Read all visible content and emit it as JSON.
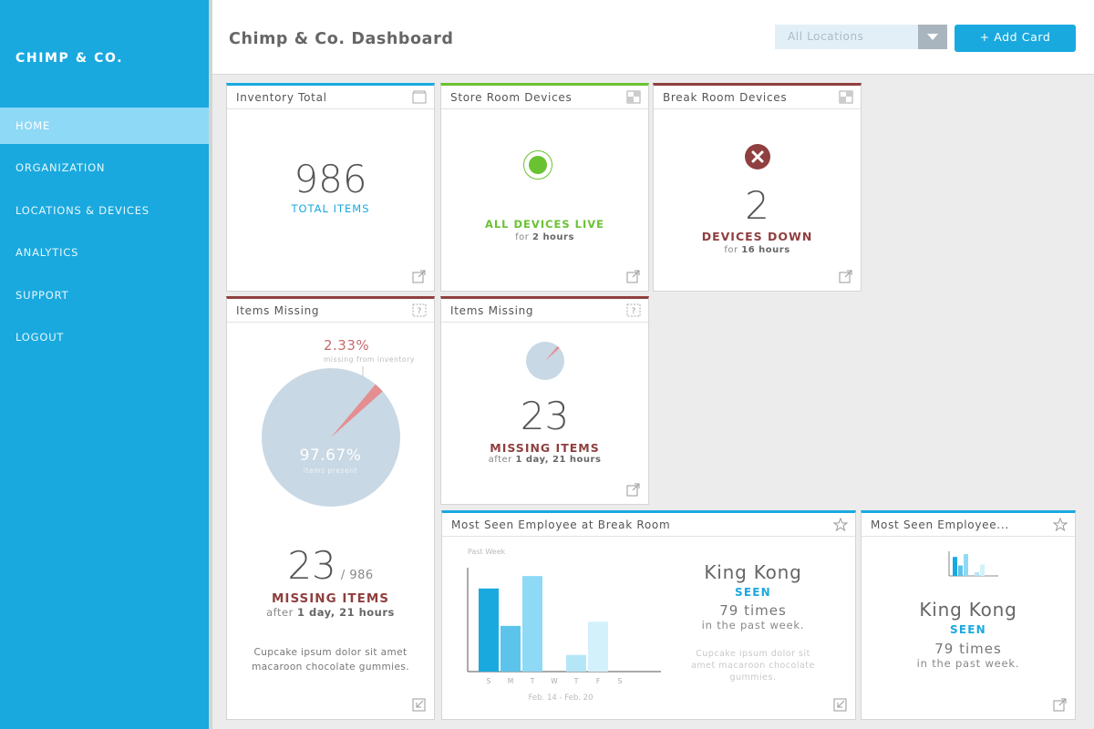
{
  "brand": "CHIMP & CO.",
  "nav": [
    "HOME",
    "ORGANIZATION",
    "LOCATIONS & DEVICES",
    "ANALYTICS",
    "SUPPORT",
    "LOGOUT"
  ],
  "header": {
    "title": "Chimp & Co. Dashboard",
    "location_select": "All Locations",
    "add_card": "+ Add Card"
  },
  "inventory": {
    "title": "Inventory Total",
    "value": "986",
    "caption": "TOTAL ITEMS"
  },
  "store_room": {
    "title": "Store Room Devices",
    "caption": "ALL DEVICES LIVE",
    "for_prefix": "for",
    "for_value": "2 hours",
    "status_color": "#6ac233"
  },
  "break_room": {
    "title": "Break Room Devices",
    "value": "2",
    "caption": "DEVICES DOWN",
    "for_prefix": "for",
    "for_value": "16 hours",
    "status_color": "#8f3f3f"
  },
  "missing_large": {
    "title": "Items Missing",
    "missing_pct": "2.33%",
    "missing_pct_sub": "missing from inventory",
    "present_pct": "97.67%",
    "present_pct_sub": "items present",
    "missing_fraction": 0.0233,
    "value": "23",
    "total": "/ 986",
    "caption": "MISSING ITEMS",
    "after_prefix": "after",
    "after_value": "1 day, 21 hours",
    "note": "Cupcake ipsum dolor sit amet macaroon chocolate gummies."
  },
  "missing_small": {
    "title": "Items Missing",
    "missing_fraction": 0.0233,
    "value": "23",
    "caption": "MISSING ITEMS",
    "after_prefix": "after",
    "after_value": "1 day, 21 hours"
  },
  "employee_break": {
    "title": "Most Seen Employee at Break Room",
    "name": "King Kong",
    "seen": "SEEN",
    "times": "79 times",
    "past": "in the past week.",
    "note": "Cupcake ipsum dolor sit amet macaroon chocolate gummies."
  },
  "employee_small": {
    "title": "Most Seen Employee...",
    "name": "King Kong",
    "seen": "SEEN",
    "times": "79 times",
    "past": "in the past week."
  },
  "chart_data": {
    "type": "bar",
    "title": "Past Week",
    "categories": [
      "S",
      "M",
      "T",
      "W",
      "T",
      "F",
      "S"
    ],
    "values": [
      20,
      11,
      23,
      0,
      4,
      12,
      0
    ],
    "colors": [
      "#19a9df",
      "#5cc4ea",
      "#8ed9f5",
      "#8ed9f5",
      "#b5e6f8",
      "#d3f1fb",
      "#d3f1fb"
    ],
    "xlabel": "Feb. 14 - Feb. 20",
    "ylim": [
      0,
      25
    ]
  },
  "colors": {
    "accent": "#19a9df",
    "green": "#6ac233",
    "red": "#8f3f3f",
    "pie": "#c8d8e4",
    "slice": "#e48e91"
  }
}
